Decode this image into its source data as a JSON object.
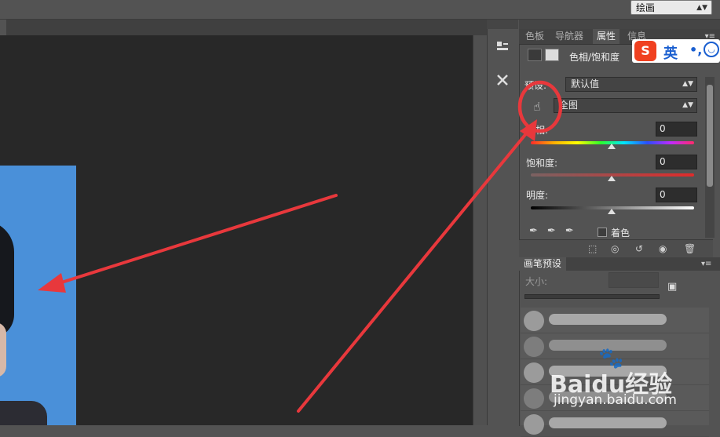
{
  "topbar": {
    "workspace": "绘画"
  },
  "properties_panel": {
    "tabs": [
      {
        "label": "色板",
        "active": false
      },
      {
        "label": "导航器",
        "active": false
      },
      {
        "label": "属性",
        "active": true
      },
      {
        "label": "信息",
        "active": false
      }
    ],
    "adjustment_title": "色相/饱和度",
    "preset_label": "预设:",
    "preset_value": "默认值",
    "range_value": "全图",
    "sliders": [
      {
        "label": "色相:",
        "value": "0"
      },
      {
        "label": "饱和度:",
        "value": "0"
      },
      {
        "label": "明度:",
        "value": "0"
      }
    ],
    "colorize_label": "着色",
    "colorize_checked": false
  },
  "brush_panel": {
    "title": "画笔预设",
    "size_label": "大小:"
  },
  "ime": {
    "logo": "S",
    "mode": "英"
  },
  "watermark": {
    "brand": "Baidu经验",
    "url": "jingyan.baidu.com"
  },
  "colors": {
    "accent_annotation": "#e8383c",
    "photo_background": "#4a90d9",
    "canvas": "#282828"
  }
}
